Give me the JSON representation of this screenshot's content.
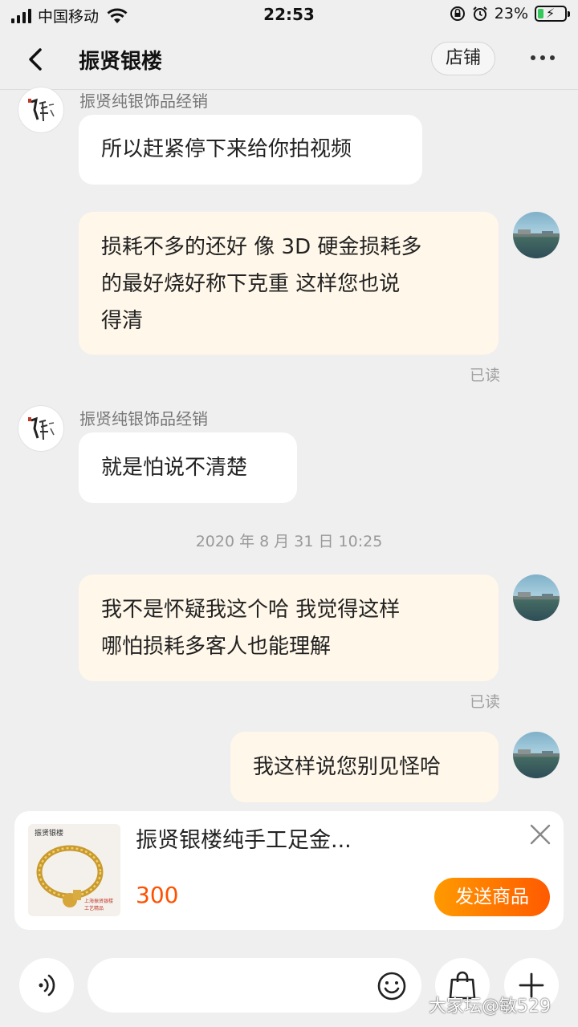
{
  "status_bar": {
    "carrier": "中国移动",
    "time": "22:53",
    "battery_percent": "23%",
    "battery_level": 0.23,
    "icons": [
      "signal-icon",
      "wifi-icon",
      "orientation-lock-icon",
      "alarm-icon",
      "battery-icon"
    ]
  },
  "header": {
    "title": "振贤银楼",
    "shop_label": "店铺",
    "icons": [
      "back-icon",
      "more-icon"
    ]
  },
  "chat": {
    "messages": [
      {
        "side": "left",
        "sender": "振贤纯银饰品经销",
        "text": "所以赶紧停下来给你拍视频"
      },
      {
        "side": "right",
        "lines": [
          "损耗不多的还好 像 3D 硬金损耗多",
          "的最好烧好称下克重 这样您也说",
          "得清"
        ],
        "status": "已读"
      },
      {
        "side": "left",
        "sender": "振贤纯银饰品经销",
        "text": "就是怕说不清楚"
      },
      {
        "side": "right",
        "lines": [
          "我不是怀疑我这个哈 我觉得这样",
          "哪怕损耗多客人也能理解"
        ],
        "status": "已读"
      },
      {
        "side": "right",
        "lines": [
          "我这样说您别见怪哈"
        ]
      }
    ],
    "timestamp": "2020 年 8 月 31 日  10:25"
  },
  "product": {
    "title": "振贤银楼纯手工足金...",
    "price": "300",
    "send_label": "发送商品",
    "thumb_caption_1": "振贤银楼",
    "thumb_caption_2": "上海振贤银楼",
    "thumb_caption_3": "工艺精品"
  },
  "input": {
    "placeholder": "",
    "icons": [
      "voice-icon",
      "emoji-icon",
      "shopping-bag-icon",
      "plus-icon"
    ]
  },
  "watermark": "大家坛@敏529",
  "colors": {
    "background": "#efefef",
    "outgoing_bubble": "#fff7e9",
    "incoming_bubble": "#ffffff",
    "accent_orange": "#ff5000",
    "battery_green": "#34c759"
  }
}
